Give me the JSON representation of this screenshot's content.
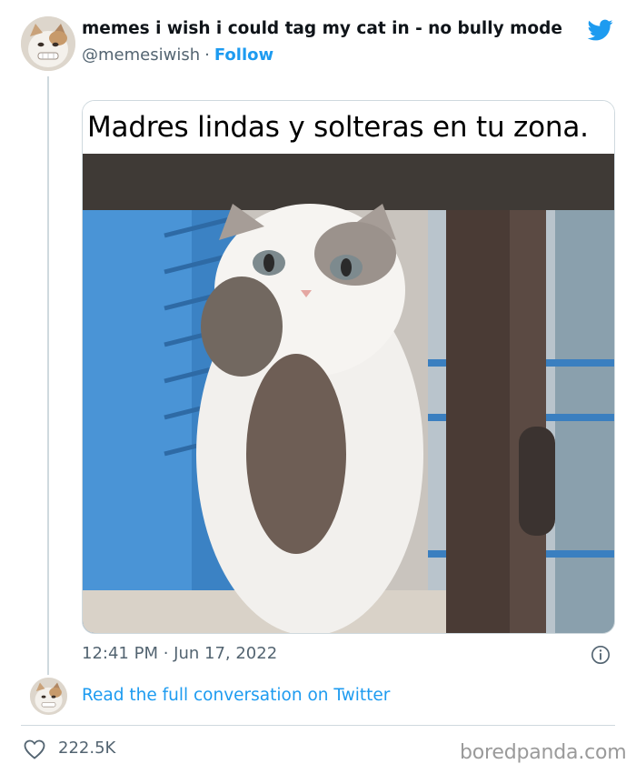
{
  "tweet": {
    "display_name": "memes i wish i could tag my cat in - no bully mode",
    "handle": "@memesiwish",
    "separator": "·",
    "follow_label": "Follow",
    "media_caption": "Madres lindas y solteras en tu zona.",
    "timestamp": "12:41 PM · Jun 17, 2022",
    "read_full_label": "Read the full conversation on Twitter",
    "likes": "222.5K"
  },
  "icons": {
    "brand": "twitter-bird-icon",
    "info": "info-icon",
    "like": "heart-icon"
  },
  "colors": {
    "twitter_blue": "#1d9bf0",
    "secondary_text": "#536471",
    "border": "#cfd9de"
  },
  "watermark": "boredpanda.com"
}
